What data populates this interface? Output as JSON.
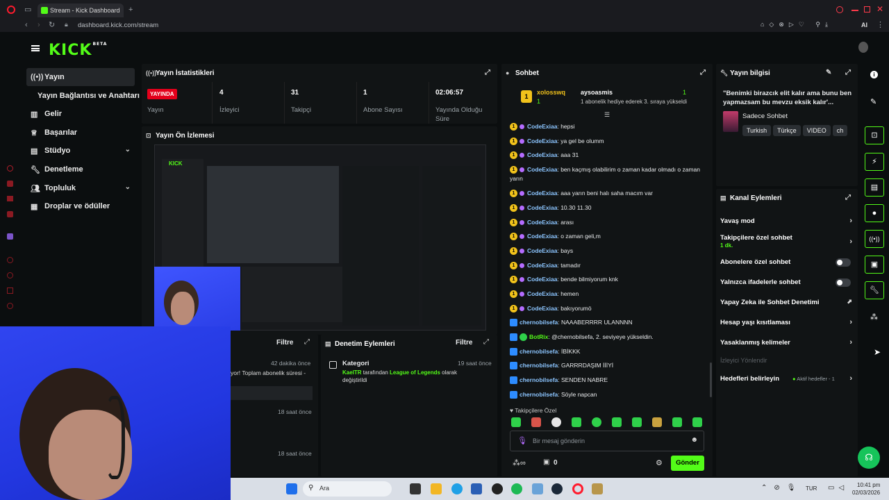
{
  "browser": {
    "tab_title": "Stream - Kick Dashboard",
    "url": "dashboard.kick.com/stream",
    "ai_label": "AI"
  },
  "kick": {
    "logo": "KICK",
    "logo_sup": "BETA"
  },
  "sidebar": {
    "items": [
      {
        "label": "Yayın",
        "icon": "broadcast-icon"
      },
      {
        "label": "Yayın Bağlantısı ve Anahtarı",
        "icon": ""
      },
      {
        "label": "Gelir",
        "icon": "chart-icon"
      },
      {
        "label": "Başarılar",
        "icon": "trophy-icon"
      },
      {
        "label": "Stüdyo",
        "icon": "studio-icon"
      },
      {
        "label": "Denetleme",
        "icon": "wrench-icon"
      },
      {
        "label": "Topluluk",
        "icon": "people-icon"
      },
      {
        "label": "Droplar ve ödüller",
        "icon": "gift-icon"
      }
    ]
  },
  "stats": {
    "title": "Yayın İstatistikleri",
    "live_badge": "YAYINDA",
    "live_label": "Yayın",
    "viewers_value": "4",
    "viewers_label": "İzleyici",
    "followers_value": "31",
    "followers_label": "Takipçi",
    "subs_value": "1",
    "subs_label": "Abone Sayısı",
    "uptime_value": "02:06:57",
    "uptime_label": "Yayında Olduğu Süre"
  },
  "preview": {
    "title": "Yayın Ön İzlemesi"
  },
  "left_bottom": {
    "filter": "Filtre",
    "time1": "42 dakika önce",
    "text1": "yor! Toplam abonelik süresi -",
    "time2": "18 saat önce",
    "time3": "18 saat önce"
  },
  "moderation": {
    "title": "Denetim Eylemleri",
    "filter": "Filtre",
    "item_title": "Kategori",
    "item_time": "19 saat önce",
    "item_user": "KaelTR",
    "item_mid": " tarafından ",
    "item_game": "League of Legends",
    "item_end": " olarak değiştirildi"
  },
  "chat": {
    "title": "Sohbet",
    "pinned_user1": "xolosswq",
    "pinned_count1": "1",
    "pinned_user2": "aysoasmis",
    "pinned_count2": "1",
    "pinned_text": "1 abonelik hediye ederek 3. sıraya yükseldi",
    "messages": [
      {
        "user": "CodeExiaa",
        "text": ": hepsi"
      },
      {
        "user": "CodeExiaa",
        "text": ": ya gel be olumm"
      },
      {
        "user": "CodeExiaa",
        "text": ": aaa 31"
      },
      {
        "user": "CodeExiaa",
        "text": ": ben kaçmış olabilirim o zaman kadar olmadı o zaman yarın"
      },
      {
        "user": "CodeExiaa",
        "text": ": aaa yarın beni halı saha macım var"
      },
      {
        "user": "CodeExiaa",
        "text": ": 10.30 11.30"
      },
      {
        "user": "CodeExiaa",
        "text": ": arası"
      },
      {
        "user": "CodeExiaa",
        "text": ": o zaman geli,m"
      },
      {
        "user": "CodeExiaa",
        "text": ": bays"
      },
      {
        "user": "CodeExiaa",
        "text": ": tamadır"
      },
      {
        "user": "CodeExiaa",
        "text": ": bende bilmiyorum knk"
      },
      {
        "user": "CodeExiaa",
        "text": ": hemen"
      },
      {
        "user": "CodeExiaa",
        "text": ": bakıyorumö"
      },
      {
        "user": "chernobilsefa",
        "text": ": NAAABERRRR ULANNNN"
      },
      {
        "user": "BotRix",
        "text": ": @chernobilsefa, 2. seviyeye yükseldin."
      },
      {
        "user": "chernobilsefa",
        "text": ": İBİKKK"
      },
      {
        "user": "chernobilsefa",
        "text": ": GARRRDAŞIM İİİYİ"
      },
      {
        "user": "chernobilsefa",
        "text": ": SENDEN NABRE"
      },
      {
        "user": "chernobilsefa",
        "text": ": Söyle napcan"
      }
    ],
    "followers_only": "Takipçilere Özel",
    "input_placeholder": "Bir mesaj gönderin",
    "count": "0",
    "send": "Gönder"
  },
  "stream_info": {
    "title": "Yayın bilgisi",
    "stream_title": "\"Benimki birazcık elit kalır ama bunu ben yapmazsam bu mevzu eksik kalır'...",
    "category": "Sadece Sohbet",
    "tags": [
      "Turkish",
      "Türkçe",
      "VIDEO",
      "ch"
    ]
  },
  "channel_actions": {
    "title": "Kanal Eylemleri",
    "slow_mode": "Yavaş mod",
    "followers_chat": "Takipçilere özel sohbet",
    "followers_chat_sub": "1 dk.",
    "subs_chat": "Abonelere özel sohbet",
    "emote_chat": "Yalnızca ifadelerle sohbet",
    "ai_mod": "Yapay Zeka ile Sohbet Denetimi",
    "age_limit": "Hesap yaşı kısıtlaması",
    "banned_words": "Yasaklanmış kelimeler",
    "redirect": "İzleyici Yönlendir",
    "goals": "Hedefleri belirleyin",
    "goals_sub": "Aktif hedefler - 1"
  },
  "taskbar": {
    "search": "Ara",
    "lang": "TUR",
    "time": "10:41 pm",
    "date": "02/03/2026"
  }
}
